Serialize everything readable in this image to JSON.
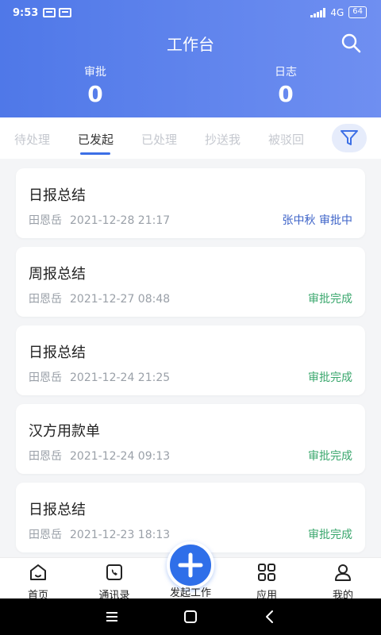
{
  "status_bar": {
    "time": "9:53",
    "network": "4G",
    "battery": "64"
  },
  "header": {
    "title": "工作台",
    "stats": [
      {
        "label": "审批",
        "value": "0"
      },
      {
        "label": "日志",
        "value": "0"
      }
    ]
  },
  "tabs": [
    "待处理",
    "已发起",
    "已处理",
    "抄送我",
    "被驳回"
  ],
  "active_tab": "已发起",
  "cards": [
    {
      "title": "日报总结",
      "author": "田恩岳",
      "datetime": "2021-12-28 21:17",
      "status": "张中秋 审批中",
      "status_type": "pending"
    },
    {
      "title": "周报总结",
      "author": "田恩岳",
      "datetime": "2021-12-27 08:48",
      "status": "审批完成",
      "status_type": "done"
    },
    {
      "title": "日报总结",
      "author": "田恩岳",
      "datetime": "2021-12-24 21:25",
      "status": "审批完成",
      "status_type": "done"
    },
    {
      "title": "汉方用款单",
      "author": "田恩岳",
      "datetime": "2021-12-24 09:13",
      "status": "审批完成",
      "status_type": "done"
    },
    {
      "title": "日报总结",
      "author": "田恩岳",
      "datetime": "2021-12-23 18:13",
      "status": "审批完成",
      "status_type": "done"
    }
  ],
  "bottom_nav": {
    "home": "首页",
    "contacts": "通讯录",
    "create": "发起工作",
    "apps": "应用",
    "mine": "我的"
  },
  "colors": {
    "header_start": "#4f78e8",
    "header_end": "#6f8ff1",
    "accent": "#2f6fe9",
    "pending": "#3d63c8",
    "done": "#3aa76d"
  }
}
